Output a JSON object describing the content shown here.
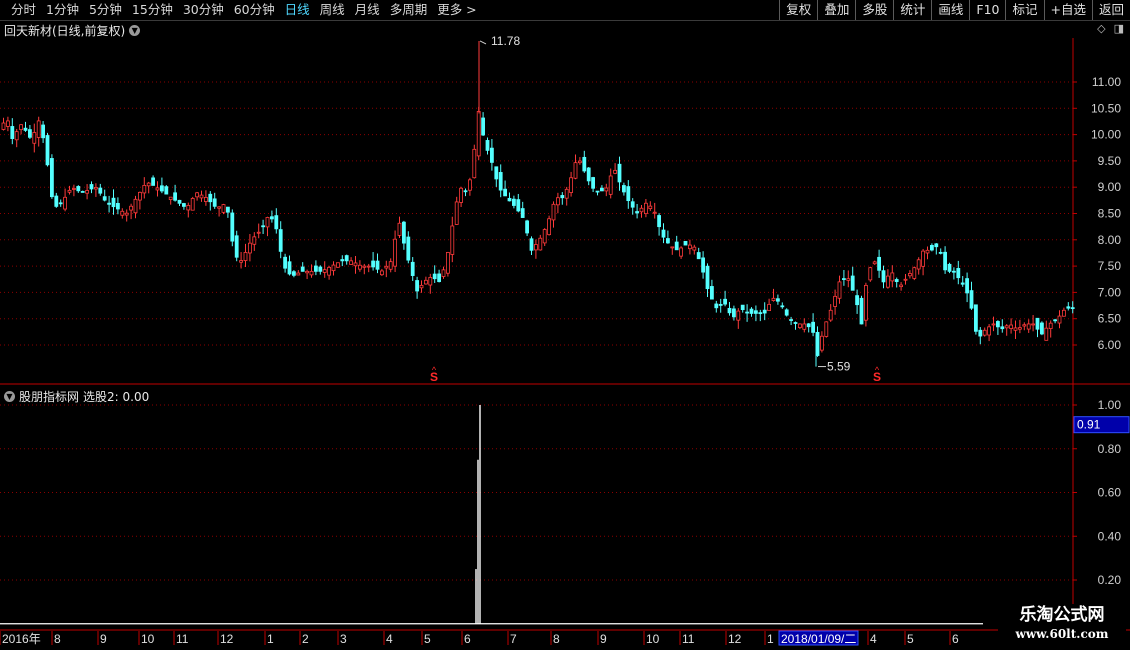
{
  "toolbar": {
    "periods": [
      "分时",
      "1分钟",
      "5分钟",
      "15分钟",
      "30分钟",
      "60分钟",
      "日线",
      "周线",
      "月线",
      "多周期",
      "更多 >"
    ],
    "active_index": 6,
    "right_buttons": [
      "复权",
      "叠加",
      "多股",
      "统计",
      "画线",
      "F10",
      "标记",
      "+自选",
      "返回"
    ]
  },
  "main_chart": {
    "title": "回天新材(日线,前复权)",
    "corner_icons": [
      "diamond-icon",
      "panel-toggle-icon"
    ],
    "y_ticks": [
      "11.00",
      "10.50",
      "10.00",
      "9.50",
      "9.00",
      "8.50",
      "8.00",
      "7.50",
      "7.00",
      "6.50",
      "6.00"
    ],
    "y_values": [
      11.0,
      10.5,
      10.0,
      9.5,
      9.0,
      8.5,
      8.0,
      7.5,
      7.0,
      6.5,
      6.0
    ],
    "high_label": "11.78",
    "low_label": "5.59",
    "signal_mark": "S",
    "colors": {
      "up": "#ff3b3b",
      "down": "#54ffff",
      "grid": "#8b0000",
      "axis": "#c00000"
    }
  },
  "indicator": {
    "title": "股朋指标网",
    "formula_label": "选股2: 0.00",
    "y_ticks": [
      "1.00",
      "0.80",
      "0.60",
      "0.40",
      "0.20"
    ],
    "y_values": [
      1.0,
      0.8,
      0.6,
      0.4,
      0.2
    ],
    "cursor_value": "0.91",
    "signal_values": [
      1.0,
      0.75,
      0.25
    ]
  },
  "time_axis": {
    "labels": [
      "2016年",
      "8",
      "9",
      "10",
      "11",
      "12",
      "1",
      "2",
      "3",
      "4",
      "5",
      "6",
      "7",
      "8",
      "9",
      "10",
      "11",
      "12",
      "1",
      "2018/01/09/二",
      "4",
      "5",
      "6"
    ],
    "highlight": "2018/01/09/二"
  },
  "watermark": {
    "line1": "乐淘公式网",
    "line2": "www.60lt.com"
  }
}
